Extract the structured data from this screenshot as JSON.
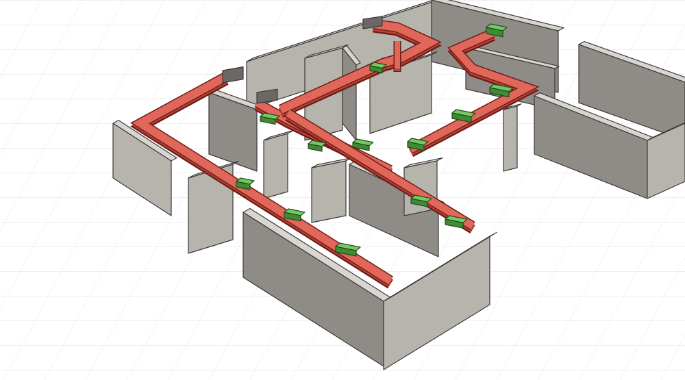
{
  "viewport": {
    "background_color": "#ffffff",
    "grid_line_color": "#e4e4e4",
    "grid_visible": true
  },
  "model": {
    "wall_top_color": "#d9d6d1",
    "wall_face_light_color": "#b7b3ad",
    "wall_face_dark_color": "#8f8b86",
    "wall_edge_color": "#3b3a38",
    "duct_top_color": "#e0675a",
    "duct_side_color": "#b9443a",
    "duct_edge_color": "#6e1d17",
    "diffuser_top_color": "#74c865",
    "diffuser_side_color": "#3f8a35",
    "diffuser_edge_color": "#1f4a1a",
    "fitting_color": "#6a6764"
  }
}
